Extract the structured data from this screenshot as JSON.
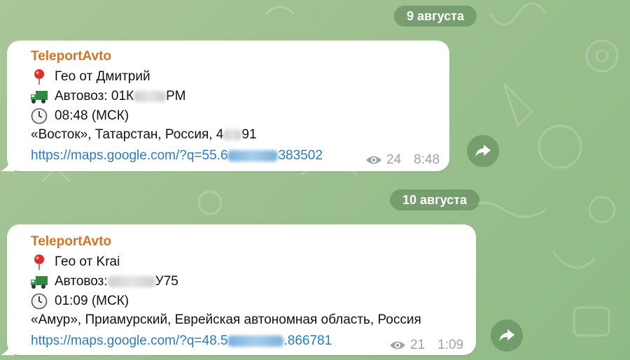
{
  "chat": {
    "groups": [
      {
        "date": "9 августа",
        "message": {
          "sender": "TeleportAvto",
          "geo": "Гео от Дмитрий",
          "truck_prefix": "Автовоз: 01К",
          "truck_suffix": "РМ",
          "time_line": "08:48 (МСК)",
          "address_prefix": "«Восток», Татарстан, Россия, 4",
          "address_suffix": "91",
          "link_prefix": "https://maps.google.com/?q=55.6",
          "link_suffix": "383502",
          "views": "24",
          "time": "8:48"
        }
      },
      {
        "date": "10 августа",
        "message": {
          "sender": "TeleportAvto",
          "geo": "Гео от Krai",
          "truck_prefix": "Автовоз: ",
          "truck_suffix": "У75",
          "time_line": "01:09 (МСК)",
          "address": "«Амур», Приамурский, Еврейская автономная область, Россия",
          "link_prefix": "https://maps.google.com/?q=48.5",
          "link_suffix": ".866781",
          "views": "21",
          "time": "1:09"
        }
      }
    ]
  },
  "icons": {
    "pin": "round-pushpin-icon",
    "truck": "delivery-truck-icon",
    "clock": "clock-icon",
    "eye": "eye-icon",
    "share": "forward-share-icon"
  },
  "colors": {
    "sender": "#d0742a",
    "link": "#2a7bbf",
    "meta": "#9da3a7",
    "background": "#9cc08f"
  }
}
